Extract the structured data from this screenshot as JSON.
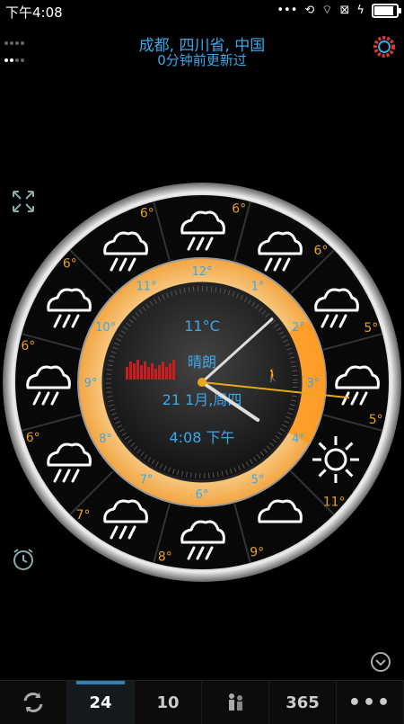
{
  "status": {
    "time": "下午4:08"
  },
  "header": {
    "location": "成都, 四川省, 中国",
    "updated": "0分钟前更新过"
  },
  "clock": {
    "temperature": "11°C",
    "condition": "晴朗",
    "date": "21 1月,周四",
    "time": "4:08 下午",
    "hours": [
      {
        "label": "12°",
        "angle": 0
      },
      {
        "label": "1°",
        "angle": 30
      },
      {
        "label": "2°",
        "angle": 60
      },
      {
        "label": "3°",
        "angle": 90
      },
      {
        "label": "4°",
        "angle": 120
      },
      {
        "label": "5°",
        "angle": 150
      },
      {
        "label": "6°",
        "angle": 180
      },
      {
        "label": "7°",
        "angle": 210
      },
      {
        "label": "8°",
        "angle": 240
      },
      {
        "label": "9°",
        "angle": 270
      },
      {
        "label": "10°",
        "angle": 300
      },
      {
        "label": "11°",
        "angle": 330
      }
    ],
    "forecast": [
      {
        "icon": "cloud-rain-icon",
        "temp": "6°",
        "angle": 0
      },
      {
        "icon": "cloud-rain-icon",
        "temp": "6°",
        "angle": 30
      },
      {
        "icon": "cloud-rain-icon",
        "temp": "5°",
        "angle": 60
      },
      {
        "icon": "cloud-rain-icon",
        "temp": "5°",
        "angle": 90
      },
      {
        "icon": "sun-icon",
        "temp": "11°",
        "angle": 120
      },
      {
        "icon": "cloud-icon",
        "temp": "9°",
        "angle": 150
      },
      {
        "icon": "cloud-rain-icon",
        "temp": "8°",
        "angle": 180
      },
      {
        "icon": "cloud-rain-icon",
        "temp": "7°",
        "angle": 210
      },
      {
        "icon": "cloud-rain-icon",
        "temp": "6°",
        "angle": 240
      },
      {
        "icon": "cloud-rain-icon",
        "temp": "6°",
        "angle": 270
      },
      {
        "icon": "cloud-rain-icon",
        "temp": "6°",
        "angle": 300
      },
      {
        "icon": "cloud-rain-icon",
        "temp": "6°",
        "angle": 330
      }
    ],
    "hands": {
      "hour": 124,
      "minute": 48,
      "second": 96
    },
    "colors": {
      "accent": "#3aa8e8",
      "temp": "#e8a020",
      "second_hand": "#e8a81a",
      "bars": "#c81e1e"
    }
  },
  "tabs": [
    {
      "label": "",
      "icon": "refresh-icon"
    },
    {
      "label": "24",
      "icon": ""
    },
    {
      "label": "10",
      "icon": ""
    },
    {
      "label": "",
      "icon": "people-icon"
    },
    {
      "label": "365",
      "icon": ""
    },
    {
      "label": "",
      "icon": "more-icon"
    }
  ]
}
